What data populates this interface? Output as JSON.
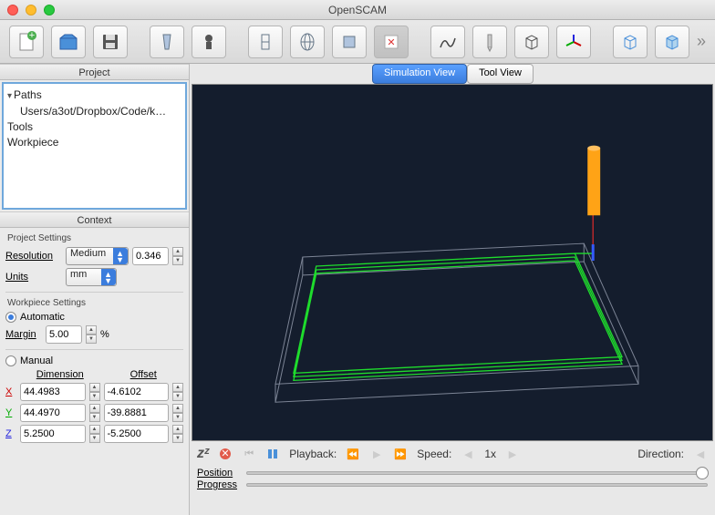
{
  "app": {
    "title": "OpenSCAM"
  },
  "tabs": {
    "sim": "Simulation View",
    "tool": "Tool View"
  },
  "project": {
    "head": "Project",
    "paths": "Paths",
    "path_item": "Users/a3ot/Dropbox/Code/k…",
    "tools": "Tools",
    "workpiece": "Workpiece"
  },
  "context": {
    "head": "Context"
  },
  "proj_settings": {
    "head": "Project Settings",
    "resolution_label": "Resolution",
    "resolution_value": "Medium",
    "resolution_num": "0.346",
    "units_label": "Units",
    "units_value": "mm"
  },
  "wp_settings": {
    "head": "Workpiece Settings",
    "auto": "Automatic",
    "margin_label": "Margin",
    "margin_value": "5.00",
    "margin_pct": "%",
    "manual": "Manual",
    "dim_head": "Dimension",
    "off_head": "Offset",
    "x": {
      "dim": "44.4983",
      "off": "-4.6102"
    },
    "y": {
      "dim": "44.4970",
      "off": "-39.8881"
    },
    "z": {
      "dim": "5.2500",
      "off": "-5.2500"
    }
  },
  "playback": {
    "zzz": "zᶻ",
    "label": "Playback:",
    "speed_label": "Speed:",
    "speed_value": "1x",
    "dir_label": "Direction:",
    "pos_label": "Position",
    "prog_label": "Progress"
  }
}
